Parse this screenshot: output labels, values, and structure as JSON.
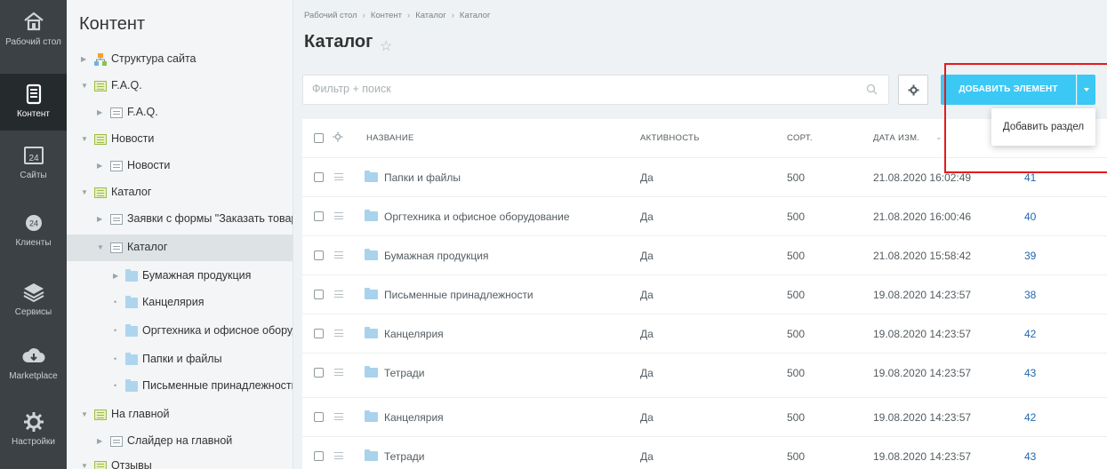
{
  "left_menu": [
    {
      "label": "Рабочий стол",
      "icon": "home-icon",
      "active": false
    },
    {
      "label": "Контент",
      "icon": "content-icon",
      "active": true
    },
    {
      "label": "Сайты",
      "icon": "calendar-icon",
      "active": false
    },
    {
      "label": "Клиенты",
      "icon": "clients-icon",
      "active": false
    },
    {
      "label": "Сервисы",
      "icon": "layers-icon",
      "active": false
    },
    {
      "label": "Marketplace",
      "icon": "cloud-download-icon",
      "active": false
    },
    {
      "label": "Настройки",
      "icon": "gear-icon",
      "active": false
    }
  ],
  "left_menu_calendar_day": "24",
  "tree": {
    "title": "Контент",
    "items": [
      {
        "label": "Структура сайта",
        "icon": "site-structure-icon"
      },
      {
        "label": "F.A.Q.",
        "icon": "iblock-type-icon"
      },
      {
        "label": "F.A.Q.",
        "icon": "iblock-icon"
      },
      {
        "label": "Новости",
        "icon": "iblock-type-icon"
      },
      {
        "label": "Новости",
        "icon": "iblock-icon"
      },
      {
        "label": "Каталог",
        "icon": "iblock-type-icon"
      },
      {
        "label": "Заявки с формы \"Заказать товар\"",
        "icon": "iblock-icon"
      },
      {
        "label": "Каталог",
        "icon": "iblock-icon"
      },
      {
        "label": "Бумажная продукция",
        "icon": "folder-icon"
      },
      {
        "label": "Канцелярия",
        "icon": "folder-icon"
      },
      {
        "label": "Оргтехника и офисное оборудование",
        "icon": "folder-icon"
      },
      {
        "label": "Папки и файлы",
        "icon": "folder-icon"
      },
      {
        "label": "Письменные принадлежности",
        "icon": "folder-icon"
      },
      {
        "label": "На главной",
        "icon": "iblock-type-icon"
      },
      {
        "label": "Слайдер на главной",
        "icon": "iblock-icon"
      },
      {
        "label": "Отзывы",
        "icon": "iblock-type-icon"
      }
    ]
  },
  "breadcrumb": [
    "Рабочий стол",
    "Контент",
    "Каталог",
    "Каталог"
  ],
  "page_title": "Каталог",
  "filter": {
    "placeholder": "Фильтр + поиск"
  },
  "toolbar": {
    "add_element_label": "ДОБАВИТЬ ЭЛЕМЕНТ",
    "dropdown_item": "Добавить раздел"
  },
  "grid": {
    "columns": {
      "name": "НАЗВАНИЕ",
      "active": "АКТИВНОСТЬ",
      "sort": "СОРТ.",
      "date": "ДАТА ИЗМ."
    },
    "rows": [
      {
        "name": "Папки и файлы",
        "active": "Да",
        "sort": "500",
        "date": "21.08.2020 16:02:49",
        "id": "41"
      },
      {
        "name": "Оргтехника и офисное оборудование",
        "active": "Да",
        "sort": "500",
        "date": "21.08.2020 16:00:46",
        "id": "40"
      },
      {
        "name": "Бумажная продукция",
        "active": "Да",
        "sort": "500",
        "date": "21.08.2020 15:58:42",
        "id": "39"
      },
      {
        "name": "Письменные принадлежности",
        "active": "Да",
        "sort": "500",
        "date": "19.08.2020 14:23:57",
        "id": "38"
      },
      {
        "name": "Канцелярия",
        "active": "Да",
        "sort": "500",
        "date": "19.08.2020 14:23:57",
        "id": "42"
      },
      {
        "name": "Тетради",
        "active": "Да",
        "sort": "500",
        "date": "19.08.2020 14:23:57",
        "id": "43"
      },
      {
        "name": "Канцелярия",
        "active": "Да",
        "sort": "500",
        "date": "19.08.2020 14:23:57",
        "id": "42"
      },
      {
        "name": "Тетради",
        "active": "Да",
        "sort": "500",
        "date": "19.08.2020 14:23:57",
        "id": "43"
      }
    ]
  },
  "colors": {
    "accent": "#3bc8f5",
    "highlight_box": "#e21b1b",
    "sidebar": "#3b4145"
  }
}
